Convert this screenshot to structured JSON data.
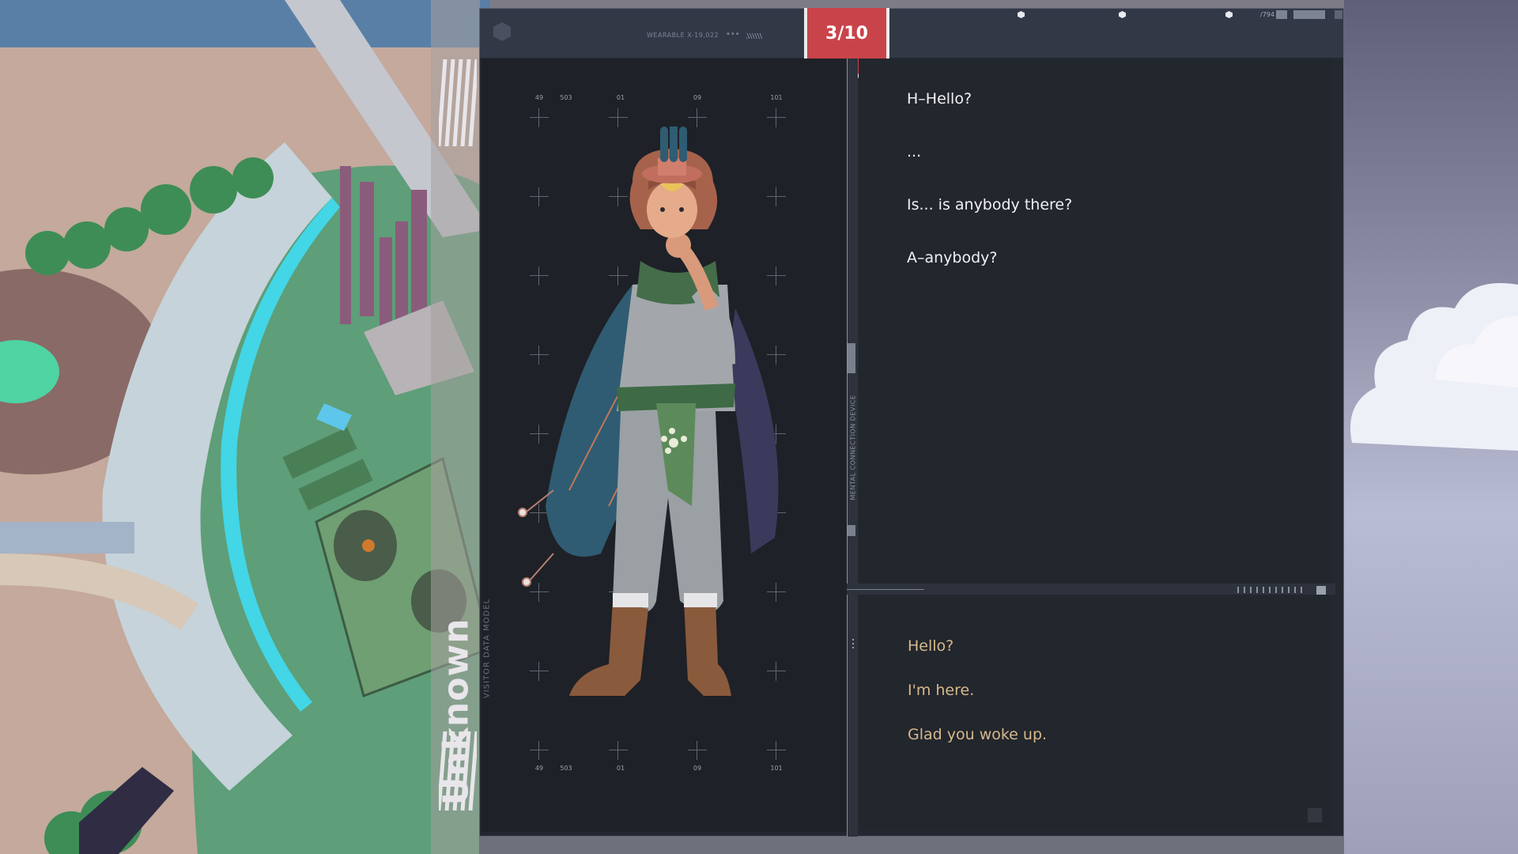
{
  "header": {
    "device_label": "WEARABLE X-19,022",
    "device_dots": "•••",
    "counter": "3/10",
    "right_code": "/794"
  },
  "character": {
    "name": "Unknown",
    "panel_label": "VISITOR DATA MODEL"
  },
  "grid": {
    "top_labels": [
      "49",
      "503",
      "01",
      "09",
      "101"
    ],
    "bottom_labels": [
      "49",
      "503",
      "01",
      "09",
      "101"
    ]
  },
  "divider": {
    "label": "MENTAL CONNECTION DEVICE"
  },
  "dialogue": {
    "lines": [
      "H–Hello?",
      "...",
      "Is... is anybody there?",
      "A–anybody?"
    ]
  },
  "responses": {
    "options": [
      "Hello?",
      "I'm here.",
      "Glad you woke up."
    ]
  },
  "colors": {
    "badge": "#c9444a",
    "response_text": "#d7b98b",
    "dialogue_text": "#f1f1f4",
    "panel_bg": "#1e2127"
  },
  "icons": {
    "logo": "hexagon-icon",
    "character": "visitor-portrait"
  }
}
